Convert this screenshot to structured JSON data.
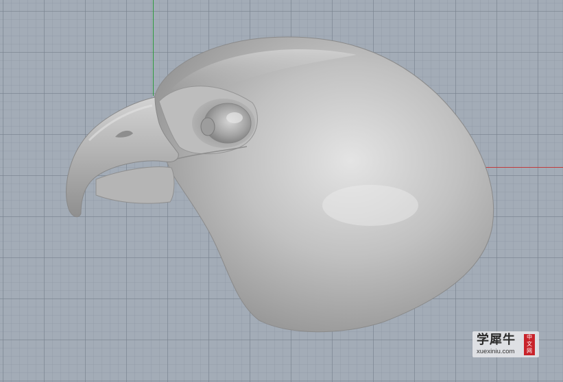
{
  "viewport": {
    "background_color": "#a3acb7",
    "grid_color": "#76808c",
    "y_axis_color": "#2e9a3e",
    "x_axis_color": "#c23a3a",
    "model_color": "#b4b4b4"
  },
  "watermark": {
    "title": "学犀牛",
    "url": "xuexiniu.com",
    "badge": "中文网"
  }
}
